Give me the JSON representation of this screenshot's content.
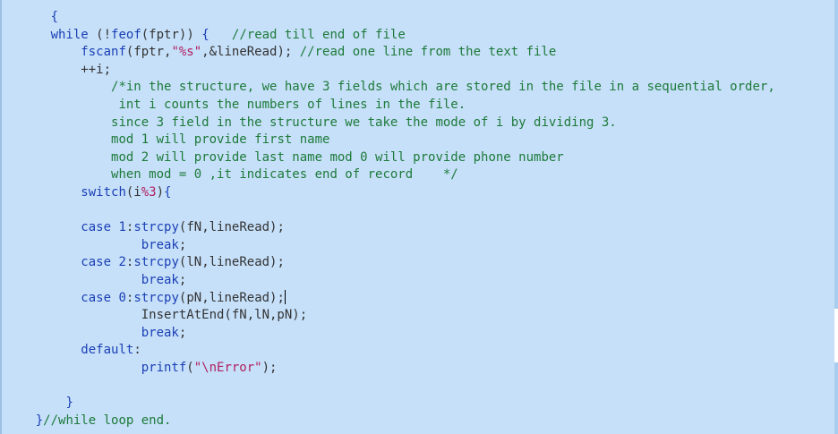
{
  "editor": {
    "lines": [
      {
        "indent": "      ",
        "parts": [
          {
            "t": "{",
            "c": "brace"
          }
        ]
      },
      {
        "indent": "      ",
        "parts": [
          {
            "t": "while",
            "c": "kw"
          },
          {
            "t": " (!",
            "c": "op"
          },
          {
            "t": "feof",
            "c": "fn"
          },
          {
            "t": "(fptr)) ",
            "c": "op"
          },
          {
            "t": "{",
            "c": "brace"
          },
          {
            "t": "   //read till end of file",
            "c": "cmt"
          }
        ]
      },
      {
        "indent": "          ",
        "parts": [
          {
            "t": "fscanf",
            "c": "fn"
          },
          {
            "t": "(fptr,",
            "c": "op"
          },
          {
            "t": "\"%s\"",
            "c": "str"
          },
          {
            "t": ",&lineRead); ",
            "c": "op"
          },
          {
            "t": "//read one line from the text file",
            "c": "cmt"
          }
        ]
      },
      {
        "indent": "          ",
        "parts": [
          {
            "t": "++i;",
            "c": "op"
          }
        ]
      },
      {
        "indent": "              ",
        "parts": [
          {
            "t": "/*in the structure, we have 3 fields which are stored in the file in a sequential order,",
            "c": "cmt"
          }
        ]
      },
      {
        "indent": "               ",
        "parts": [
          {
            "t": "int i counts the numbers of lines in the file.",
            "c": "cmt"
          }
        ]
      },
      {
        "indent": "              ",
        "parts": [
          {
            "t": "since 3 field in the structure we take the mode of i by dividing 3.",
            "c": "cmt"
          }
        ]
      },
      {
        "indent": "              ",
        "parts": [
          {
            "t": "mod 1 will provide first name",
            "c": "cmt"
          }
        ]
      },
      {
        "indent": "              ",
        "parts": [
          {
            "t": "mod 2 will provide last name mod 0 will provide phone number",
            "c": "cmt"
          }
        ]
      },
      {
        "indent": "              ",
        "parts": [
          {
            "t": "when mod = 0 ,it indicates end of record    */",
            "c": "cmt"
          }
        ]
      },
      {
        "indent": "          ",
        "parts": [
          {
            "t": "switch",
            "c": "kw"
          },
          {
            "t": "(i",
            "c": "op"
          },
          {
            "t": "%3",
            "c": "str"
          },
          {
            "t": ")",
            "c": "op"
          },
          {
            "t": "{",
            "c": "brace"
          }
        ]
      },
      {
        "indent": "",
        "parts": []
      },
      {
        "indent": "          ",
        "parts": [
          {
            "t": "case ",
            "c": "kw"
          },
          {
            "t": "1",
            "c": "num"
          },
          {
            "t": ":",
            "c": "op"
          },
          {
            "t": "strcpy",
            "c": "fn"
          },
          {
            "t": "(fN,lineRead);",
            "c": "op"
          }
        ]
      },
      {
        "indent": "                  ",
        "parts": [
          {
            "t": "break",
            "c": "kw"
          },
          {
            "t": ";",
            "c": "op"
          }
        ]
      },
      {
        "indent": "          ",
        "parts": [
          {
            "t": "case ",
            "c": "kw"
          },
          {
            "t": "2",
            "c": "num"
          },
          {
            "t": ":",
            "c": "op"
          },
          {
            "t": "strcpy",
            "c": "fn"
          },
          {
            "t": "(lN,lineRead);",
            "c": "op"
          }
        ]
      },
      {
        "indent": "                  ",
        "parts": [
          {
            "t": "break",
            "c": "kw"
          },
          {
            "t": ";",
            "c": "op"
          }
        ]
      },
      {
        "indent": "          ",
        "parts": [
          {
            "t": "case ",
            "c": "kw"
          },
          {
            "t": "0",
            "c": "num"
          },
          {
            "t": ":",
            "c": "op"
          },
          {
            "t": "strcpy",
            "c": "fn"
          },
          {
            "t": "(pN,lineRead);",
            "c": "op"
          }
        ],
        "caret": true
      },
      {
        "indent": "                  ",
        "parts": [
          {
            "t": "InsertAtEnd(fN,lN,pN);",
            "c": "op"
          }
        ]
      },
      {
        "indent": "                  ",
        "parts": [
          {
            "t": "break",
            "c": "kw"
          },
          {
            "t": ";",
            "c": "op"
          }
        ]
      },
      {
        "indent": "          ",
        "parts": [
          {
            "t": "default",
            "c": "kw"
          },
          {
            "t": ":",
            "c": "op"
          }
        ]
      },
      {
        "indent": "                  ",
        "parts": [
          {
            "t": "printf",
            "c": "fn"
          },
          {
            "t": "(",
            "c": "op"
          },
          {
            "t": "\"\\nError\"",
            "c": "str"
          },
          {
            "t": ");",
            "c": "op"
          }
        ]
      },
      {
        "indent": "",
        "parts": []
      },
      {
        "indent": "        ",
        "parts": [
          {
            "t": "}",
            "c": "brace"
          }
        ]
      },
      {
        "indent": "    ",
        "parts": [
          {
            "t": "}",
            "c": "brace"
          },
          {
            "t": "//while loop end.",
            "c": "cmt"
          }
        ]
      }
    ]
  }
}
